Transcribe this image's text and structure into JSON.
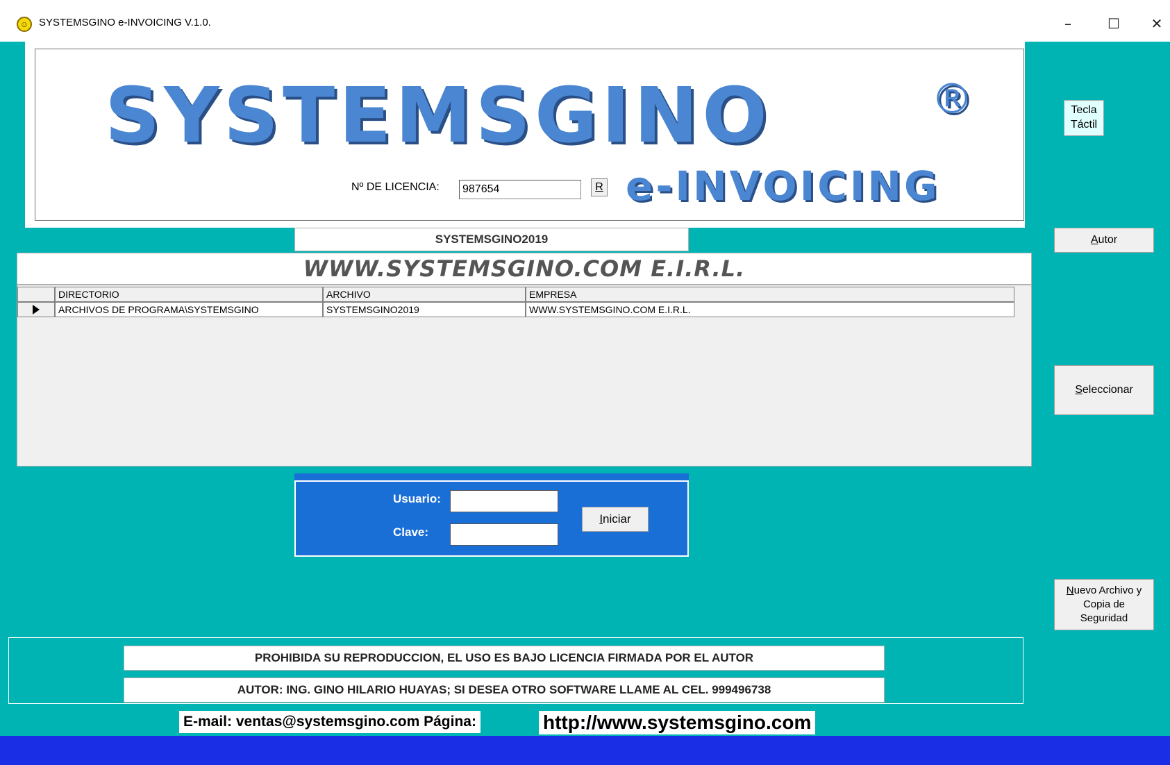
{
  "window": {
    "title": "SYSTEMSGINO e-INVOICING V.1.0.",
    "app_icon": "smiley-icon",
    "minimize_glyph": "–",
    "maximize_glyph": "☐",
    "close_glyph": "✕"
  },
  "logo": {
    "brand": "SYSTEMSGINO",
    "registered": "®",
    "product": "e-INVOICING"
  },
  "license": {
    "label": "Nº DE LICENCIA:",
    "value": "987654",
    "refresh_label": "R"
  },
  "side_buttons": {
    "tecla_line1": "Tecla",
    "tecla_line2": "Táctil",
    "autor_key": "A",
    "autor_rest": "utor",
    "seleccionar_key": "S",
    "seleccionar_rest": "eleccionar",
    "nuevo_key": "N",
    "nuevo_line1_rest": "uevo Archivo y",
    "nuevo_line2": "Copia de",
    "nuevo_line3": "Seguridad"
  },
  "company": {
    "file": "SYSTEMSGINO2019",
    "banner": "WWW.SYSTEMSGINO.COM E.I.R.L."
  },
  "grid": {
    "headers": {
      "directorio": "DIRECTORIO",
      "archivo": "ARCHIVO",
      "empresa": "EMPRESA"
    },
    "rows": [
      {
        "directorio": "ARCHIVOS DE PROGRAMA\\SYSTEMSGINO",
        "archivo": "SYSTEMSGINO2019",
        "empresa": "WWW.SYSTEMSGINO.COM E.I.R.L."
      }
    ]
  },
  "login": {
    "usuario_label": "Usuario:",
    "clave_label": "Clave:",
    "usuario_value": "",
    "clave_value": "",
    "iniciar_key": "I",
    "iniciar_rest": "niciar"
  },
  "footer": {
    "notice_1": "PROHIBIDA SU REPRODUCCION, EL USO ES BAJO LICENCIA FIRMADA POR EL AUTOR",
    "notice_2": "AUTOR: ING. GINO HILARIO HUAYAS; SI DESEA OTRO SOFTWARE LLAME AL CEL. 999496738",
    "email_label": "E-mail: ventas@systemsgino.com   Página:",
    "url": "http://www.systemsgino.com"
  },
  "colors": {
    "background": "#00b4b4",
    "login_panel": "#1a6fd6",
    "statusbar": "#1a2ee6",
    "logo_text": "#4a86d2"
  }
}
